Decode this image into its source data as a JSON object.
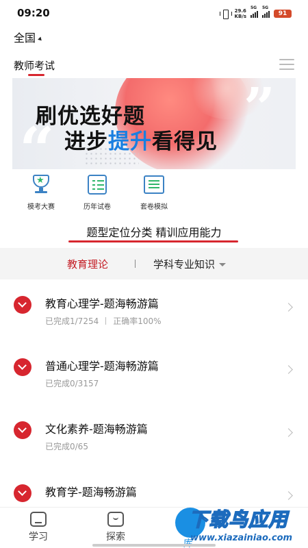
{
  "status": {
    "time": "09:20",
    "net_speed_value": "29.6",
    "net_speed_unit": "KB/s",
    "sim1": "5G",
    "sim2": "5G",
    "battery": "91"
  },
  "region": {
    "label": "全国"
  },
  "header": {
    "exam_tab": "教师考试"
  },
  "banner": {
    "line1": "刷优选好题",
    "line2_a": "进步",
    "line2_highlight": "提升",
    "line2_b": "看得见",
    "highlight_color": "#1a7fe0"
  },
  "quick_actions": [
    {
      "label": "模考大赛",
      "icon": "trophy-icon"
    },
    {
      "label": "历年试卷",
      "icon": "exam-paper-icon"
    },
    {
      "label": "套卷模拟",
      "icon": "book-icon"
    }
  ],
  "section": {
    "title": "题型定位分类 精训应用能力"
  },
  "subjects": {
    "active": "教育理论",
    "other": "学科专业知识"
  },
  "list": [
    {
      "title": "教育心理学-题海畅游篇",
      "progress": "已完成1/7254",
      "accuracy": "正确率100%"
    },
    {
      "title": "普通心理学-题海畅游篇",
      "progress": "已完成0/3157",
      "accuracy": ""
    },
    {
      "title": "文化素养-题海畅游篇",
      "progress": "已完成0/65",
      "accuracy": ""
    },
    {
      "title": "教育学-题海畅游篇",
      "progress": "",
      "accuracy": ""
    }
  ],
  "bottom_nav": {
    "study": "学习",
    "explore": "探索",
    "active_partial": "库"
  },
  "watermark": {
    "text": "下载鸟应用",
    "url": "www.xiazainiao.com"
  },
  "colors": {
    "accent_red": "#d7262f",
    "accent_blue": "#1a8fe3"
  }
}
